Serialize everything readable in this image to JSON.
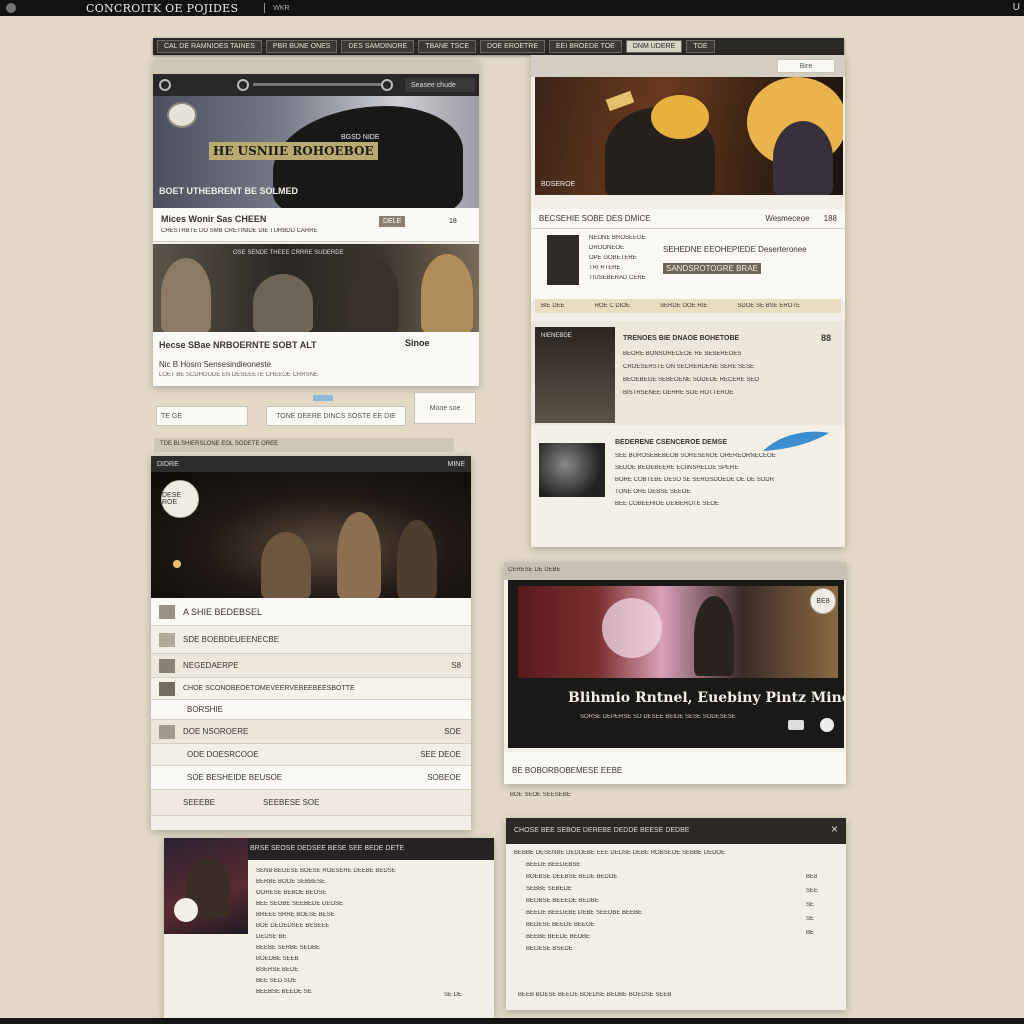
{
  "window": {
    "title": "CONCROITK OE POJIDES",
    "subtitle": "WKR",
    "right_glyph": "U"
  },
  "tabs": [
    "CAL DE RAMNIOES TAINES",
    "PBR BUNE ONES",
    "DES SAMDINORE",
    "TBANE TSCE",
    "DOE EROETRE",
    "EEI BROEDE TOE",
    "DNM UDERE",
    "TOE"
  ],
  "panel_a": {
    "search_label": "Seasee chude",
    "hero_title": "HE USNIIE ROHOEBOE",
    "hero_badge": "BGSD NIDE",
    "hero_caption": "BOET UTHEBRENT BE SOLMED",
    "item1_title": "Mices Wonir Sas CHEEN",
    "item1_sub": "CHESTRBTE DO SMB CRETINIDE DIE TURBDD CARRE",
    "item1_stamp": "DELE",
    "item1_num": "18",
    "strip_text": "OSE SENDE THEEE CRRRE SUDERDE",
    "item2_title": "Hecse SBae NRBOERNTE SOBT ALT",
    "item2_sub": "Nic B Hosm Sensesindieoneste",
    "item2_stamp": "Sinoe",
    "item2_foot": "LOET BE SCDHOUDE EN DESEEETE CHEEOE CRRSNE",
    "bottom_left": "TE GE",
    "bottom_mid": "TONE DEERE DINCS SOSTE EE DIE",
    "bottom_right": "Mone soe",
    "tab_strip": "TDE BLSHIERSLONE EOL SODETE OREE"
  },
  "panel_b": {
    "header_btn": "Bire",
    "hero_caption": "BDSEROE",
    "meta_left": "BECSEHIE SOBE DES DMICE",
    "meta_right": "Wesmeceoe",
    "meta_num": "188",
    "profile_lines": [
      "NEONE BROSEEGE",
      "DROONEOE",
      "OPE GOBETERE",
      "TRI RTERE",
      "TIUSEBERAD CERE"
    ],
    "profile_title": "SEHEDNE EEOHEPIEDE Deserteronee",
    "profile_highlight": "SANDSROTOGRE BRAE",
    "band": [
      "BIE DEE",
      "ROE C DIOE",
      "SERDE OOE RIE",
      "SDOE SE BSE EROTE"
    ],
    "news1_tag": "NIENEBDE",
    "news1_title": "TRENOES BIE DNAOE BOHETOBE",
    "news1_lines": [
      "BEORE BONSORECEOE RE SESEREOES",
      "CROESERSTE ON SECRERDENE SERE SESE",
      "BEOEBEGE SEBEOENE SODEDE RECERE SEO",
      "BISTRSENEE OEHRE SOE ROTTEROE"
    ],
    "news1_corner": "88",
    "news2_title": "BEDERENE CSENCEROE DEMSE",
    "news2_lines": [
      "SEE BUROSEBEBEOB SORESENOE OREREORNECEOE",
      "SEDOE BEOEBEERE ECIINSHELDE SPERE",
      "BORE COBTEBE DESO SE SERGSDOEDE OE DE SODR",
      "TONE ORE DEBSE SEEOE",
      "BEE COBEEHIOE DEIBEROTE SEOE"
    ]
  },
  "panel_c": {
    "header_left": "DIDRE",
    "header_right": "MINE",
    "circle_badge": "DESE ROE",
    "rows": [
      {
        "label": "A SHIE BEDEBSEL",
        "right": ""
      },
      {
        "label": "SDE BOEBDEUEENECBE",
        "right": ""
      },
      {
        "label": "NEGEDAERPE",
        "right": "S8"
      },
      {
        "label": "CHOE SCONOBEOETOMEVEERVEBEEBEESBOTTE",
        "right": ""
      },
      {
        "label": "BORSHIE",
        "right": ""
      },
      {
        "label": "DOE NSOROERE",
        "right": "SOE"
      },
      {
        "label": "ODE DOESRCOOE",
        "right": "SEE DEOE"
      },
      {
        "label": "SOE BESHEIDE BEUSOE",
        "right": "SOBEOE"
      },
      {
        "label": "SEEEBE",
        "right": "SEEBESE SOE"
      }
    ]
  },
  "panel_d": {
    "header": "CERESE DE DEBE",
    "badge": "BE8",
    "caption": "Blihmio Rntnel, Euebiny Pintz Mine",
    "sub": "SORSE DEPERSE SO DESEE BEIDE SESE SODESESE",
    "foot": "BE BOBORBOBEMESE EEBE",
    "foot2": "BOE SEOE SEESEBE"
  },
  "panel_e": {
    "header": "BRSE SEOSE DEDSEE BESE SEE BEDE DETE",
    "lines": [
      "SENB BEDESE BOESE ROESERE DEEBE BEDSE",
      "BERBE BOOE SEBBESE",
      "OORESE BEBOE BEOSE",
      "BEE SEOBE SEEBEDE DEOSE",
      "BREEE SRRE BOESE BESE",
      "BOE DEOEDSEE BESEEE",
      "DEDSE BE",
      "BEEBE SERBE SEDBE",
      "BOEDBE SEEB",
      "BSERSE BEDE",
      "BEE SED SOE",
      "BEEBSE BEEDE SE"
    ],
    "foot": "SE DE"
  },
  "panel_f": {
    "header": "CHOSE BEE SEBOE DEREBE DEDDE BEESE DEDBE",
    "lines": [
      "BEBBE DESENBE DEDDEBE EEE DEDSE DEBE ROBSEOE SEBBE DEDOE",
      "BEEDE BEEDEBSE",
      "BOEBSE DEEBSE BEDE BEDOE",
      "SEBBE SEBEDE",
      "BEOBSE BEEEDE BEDBE",
      "BEEDE BEEDEBE DEBE SEEDBE BEEBE",
      "BEDESE BEEDE BEEOE",
      "BEEBE BEEDE BEDBE",
      "BEOESE BSEDE"
    ],
    "side": [
      "BE8",
      "SEE",
      "SE",
      "SE",
      "BE"
    ],
    "foot": "BEEB BOESE BEEDE BOEDSE BEDBE BOEDSE SEEB"
  }
}
